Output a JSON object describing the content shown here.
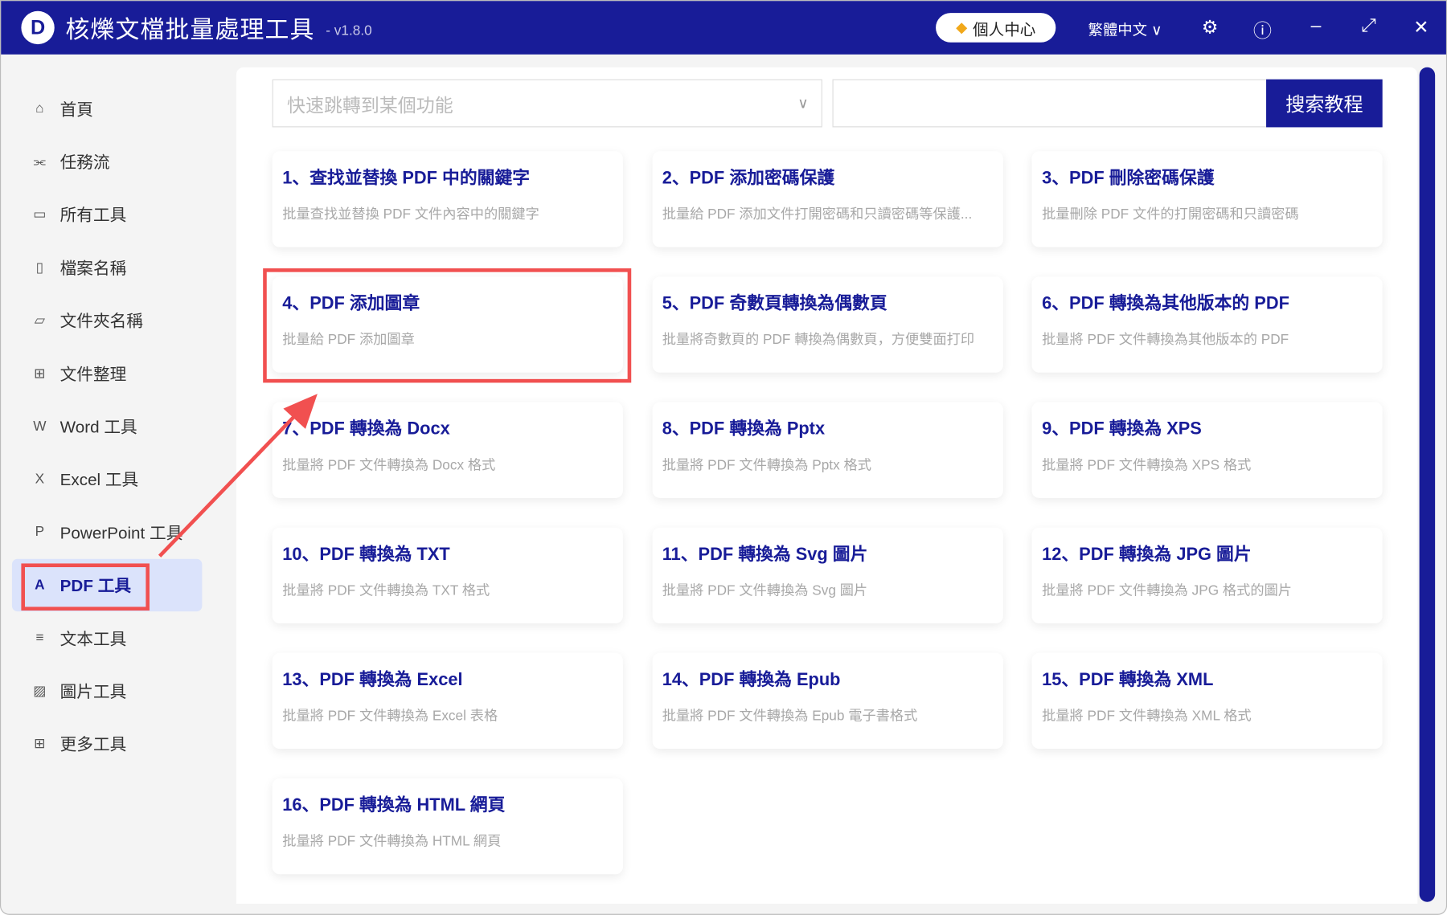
{
  "app": {
    "title": "核爍文檔批量處理工具",
    "version": "- v1.8.0",
    "personal_center": "個人中心",
    "language": "繁體中文"
  },
  "sidebar": {
    "items": [
      {
        "label": "首頁",
        "icon": "home-icon",
        "ch": "⌂"
      },
      {
        "label": "任務流",
        "icon": "workflow-icon",
        "ch": "⫘"
      },
      {
        "label": "所有工具",
        "icon": "monitor-icon",
        "ch": "▭"
      },
      {
        "label": "檔案名稱",
        "icon": "file-icon",
        "ch": "▯"
      },
      {
        "label": "文件夾名稱",
        "icon": "folder-icon",
        "ch": "▱"
      },
      {
        "label": "文件整理",
        "icon": "organize-icon",
        "ch": "⊞"
      },
      {
        "label": "Word 工具",
        "icon": "word-icon",
        "ch": "W"
      },
      {
        "label": "Excel 工具",
        "icon": "excel-icon",
        "ch": "X"
      },
      {
        "label": "PowerPoint 工具",
        "icon": "powerpoint-icon",
        "ch": "P"
      },
      {
        "label": "PDF 工具",
        "icon": "pdf-icon",
        "ch": "A"
      },
      {
        "label": "文本工具",
        "icon": "text-icon",
        "ch": "≡"
      },
      {
        "label": "圖片工具",
        "icon": "image-icon",
        "ch": "▨"
      },
      {
        "label": "更多工具",
        "icon": "more-icon",
        "ch": "⊞"
      }
    ],
    "active_index": 9
  },
  "search": {
    "jump_placeholder": "快速跳轉到某個功能",
    "search_button": "搜索教程",
    "search_value": ""
  },
  "cards": [
    {
      "title": "1、查找並替換 PDF 中的關鍵字",
      "desc": "批量查找並替換 PDF 文件內容中的關鍵字"
    },
    {
      "title": "2、PDF 添加密碼保護",
      "desc": "批量給 PDF 添加文件打開密碼和只讀密碼等保護..."
    },
    {
      "title": "3、PDF 刪除密碼保護",
      "desc": "批量刪除 PDF 文件的打開密碼和只讀密碼"
    },
    {
      "title": "4、PDF 添加圖章",
      "desc": "批量給 PDF 添加圖章"
    },
    {
      "title": "5、PDF 奇數頁轉換為偶數頁",
      "desc": "批量將奇數頁的 PDF 轉換為偶數頁，方便雙面打印"
    },
    {
      "title": "6、PDF 轉換為其他版本的 PDF",
      "desc": "批量將 PDF 文件轉換為其他版本的 PDF"
    },
    {
      "title": "7、PDF 轉換為 Docx",
      "desc": "批量將 PDF 文件轉換為 Docx 格式"
    },
    {
      "title": "8、PDF 轉換為 Pptx",
      "desc": "批量將 PDF 文件轉換為 Pptx 格式"
    },
    {
      "title": "9、PDF 轉換為 XPS",
      "desc": "批量將 PDF 文件轉換為 XPS 格式"
    },
    {
      "title": "10、PDF 轉換為 TXT",
      "desc": "批量將 PDF 文件轉換為 TXT 格式"
    },
    {
      "title": "11、PDF 轉換為 Svg 圖片",
      "desc": "批量將 PDF 文件轉換為 Svg 圖片"
    },
    {
      "title": "12、PDF 轉換為 JPG 圖片",
      "desc": "批量將 PDF 文件轉換為 JPG 格式的圖片"
    },
    {
      "title": "13、PDF 轉換為 Excel",
      "desc": "批量將 PDF 文件轉換為 Excel 表格"
    },
    {
      "title": "14、PDF 轉換為 Epub",
      "desc": "批量將 PDF 文件轉換為 Epub 電子書格式"
    },
    {
      "title": "15、PDF 轉換為 XML",
      "desc": "批量將 PDF 文件轉換為 XML 格式"
    },
    {
      "title": "16、PDF 轉換為 HTML 網頁",
      "desc": "批量將 PDF 文件轉換為 HTML 網頁"
    }
  ],
  "colors": {
    "brand": "#181c98",
    "highlight": "#f15050"
  }
}
